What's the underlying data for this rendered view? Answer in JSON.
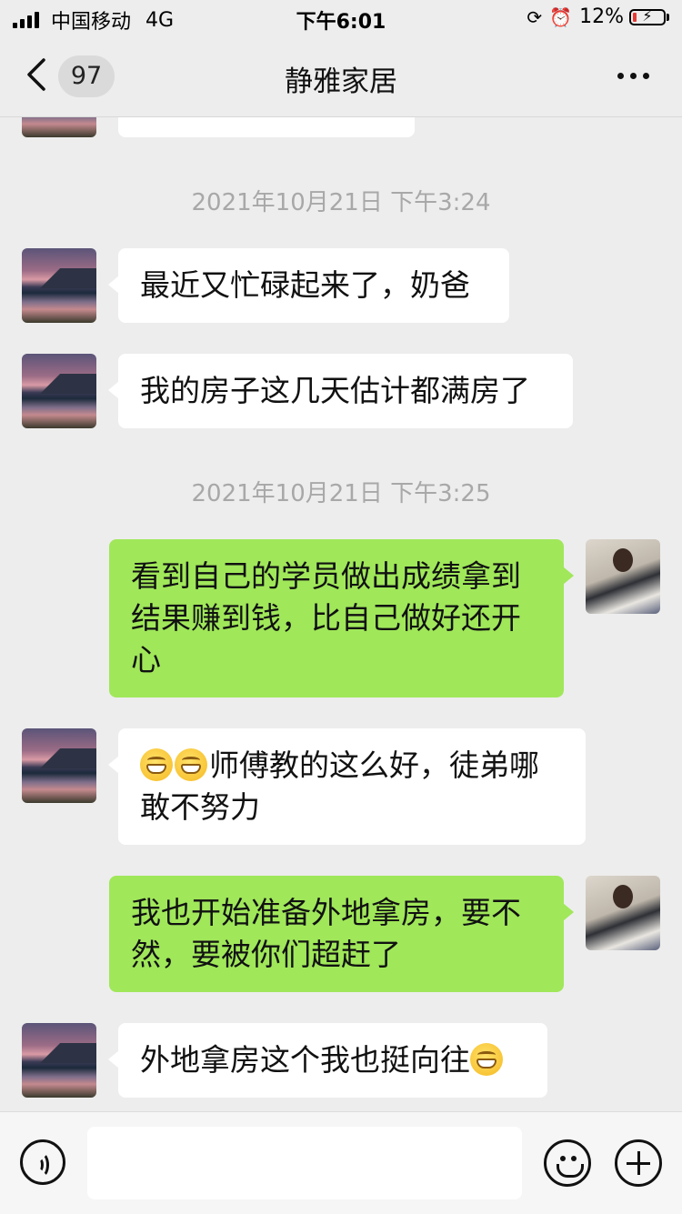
{
  "status_bar": {
    "carrier": "中国移动",
    "network": "4G",
    "time": "下午6:01",
    "battery": "12%",
    "battery_level": 0.12
  },
  "nav": {
    "unread_count": "97",
    "title": "静雅家居"
  },
  "messages": [
    {
      "type": "timestamp",
      "text": "2021年10月21日 下午3:24"
    },
    {
      "type": "in",
      "avatar": "landscape-avatar",
      "text": "最近又忙碌起来了，奶爸"
    },
    {
      "type": "in",
      "avatar": "landscape-avatar",
      "text": "我的房子这几天估计都满房了"
    },
    {
      "type": "timestamp",
      "text": "2021年10月21日 下午3:25"
    },
    {
      "type": "out",
      "avatar": "father-baby-avatar",
      "text": "看到自己的学员做出成绩拿到结果赚到钱，比自己做好还开心"
    },
    {
      "type": "in",
      "avatar": "landscape-avatar",
      "emoji_before": [
        "grin-emoji",
        "grin-emoji"
      ],
      "text": "师傅教的这么好，徒弟哪敢不努力"
    },
    {
      "type": "out",
      "avatar": "father-baby-avatar",
      "text": "我也开始准备外地拿房，要不然，要被你们超赶了"
    },
    {
      "type": "in",
      "avatar": "landscape-avatar",
      "text": "外地拿房这个我也挺向往",
      "emoji_after": [
        "grin-emoji"
      ]
    }
  ],
  "input_bar": {
    "voice_icon": "voice-icon",
    "emoji_icon": "emoji-icon",
    "plus_icon": "plus-icon",
    "input_value": ""
  },
  "colors": {
    "background": "#ededed",
    "outgoing_bubble": "#a0e75a",
    "incoming_bubble": "#ffffff",
    "timestamp_text": "#a8a8a8"
  }
}
